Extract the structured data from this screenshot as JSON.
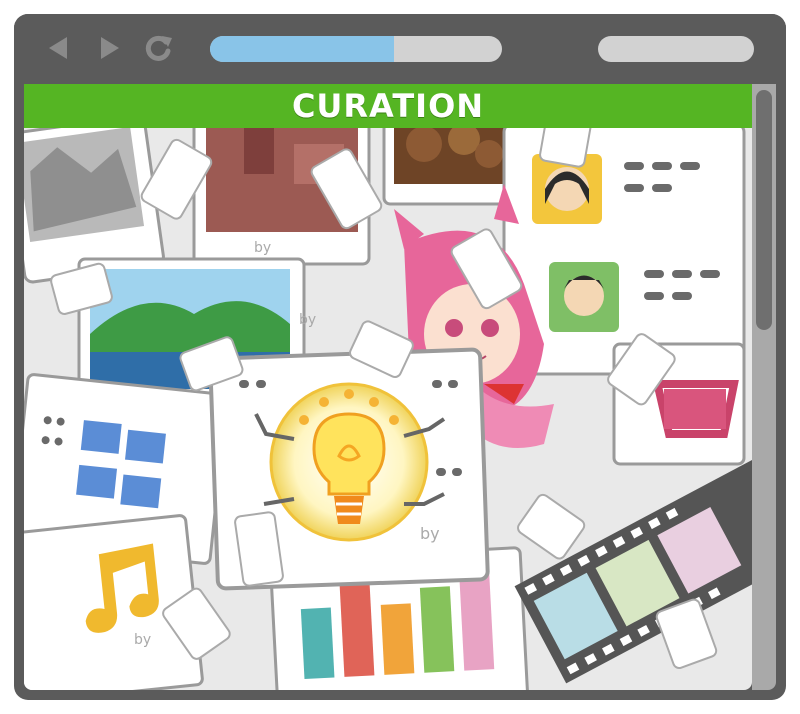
{
  "header": {
    "title": "CURATION"
  },
  "browser": {
    "load_progress": 0.63
  },
  "colors": {
    "frame": "#5b5b5b",
    "header": "#55b523",
    "progress": "#89c4e8",
    "bar_gray": "#d2d2d2"
  },
  "icons": {
    "back": "back-arrow-icon",
    "forward": "forward-arrow-icon",
    "reload": "reload-icon"
  },
  "cards": {
    "byline": "by"
  }
}
